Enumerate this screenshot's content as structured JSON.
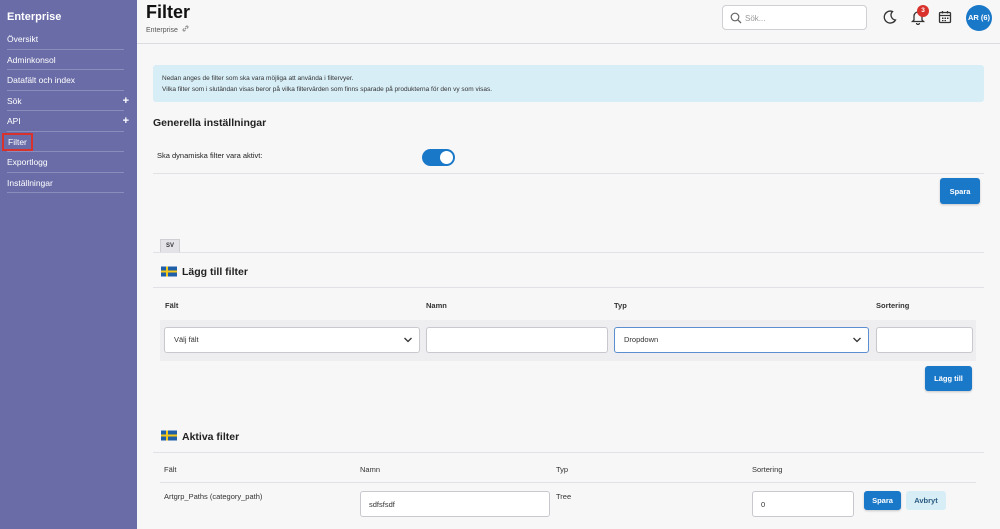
{
  "sidebar": {
    "title": "Enterprise",
    "items": [
      {
        "label": "Översikt",
        "expandable": false
      },
      {
        "label": "Adminkonsol",
        "expandable": false
      },
      {
        "label": "Datafält och index",
        "expandable": false
      },
      {
        "label": "Sök",
        "expandable": true
      },
      {
        "label": "API",
        "expandable": true
      },
      {
        "label": "Filter",
        "expandable": false,
        "active": true
      },
      {
        "label": "Exportlogg",
        "expandable": false
      },
      {
        "label": "Inställningar",
        "expandable": false
      }
    ],
    "plus_symbol": "+"
  },
  "header": {
    "title": "Filter",
    "breadcrumb": "Enterprise",
    "breadcrumb_icon": "link-icon",
    "search_placeholder": "Sök...",
    "notification_count": "3",
    "avatar_text": "AR (6)",
    "icons": [
      "search-icon",
      "moon-icon",
      "bell-icon",
      "calendar-icon"
    ]
  },
  "info": {
    "line1": "Nedan anges de filter som ska vara möjliga att använda i filtervyer.",
    "line2": "Vilka filter som i slutändan visas beror på vilka filtervärden som finns sparade på produkterna för den vy som visas."
  },
  "general": {
    "title": "Generella inställningar",
    "dynamic_label": "Ska dynamiska filter vara aktivt:",
    "dynamic_enabled": true,
    "save_label": "Spara"
  },
  "language_tab": "SV",
  "add_filter": {
    "title": "Lägg till filter",
    "columns": {
      "field": "Fält",
      "name": "Namn",
      "type": "Typ",
      "sort": "Sortering"
    },
    "field_select": "Välj fält",
    "name_value": "",
    "type_select": "Dropdown",
    "sort_value": "",
    "add_label": "Lägg till"
  },
  "active_filters": {
    "title": "Aktiva filter",
    "columns": {
      "field": "Fält",
      "name": "Namn",
      "type": "Typ",
      "sort": "Sortering"
    },
    "rows": [
      {
        "field": "Artgrp_Paths (category_path)",
        "name": "sdfsfsdf",
        "type": "Tree",
        "sort": "0",
        "save_label": "Spara",
        "cancel_label": "Avbryt"
      }
    ]
  },
  "colors": {
    "sidebar_bg": "#6a6ca8",
    "primary": "#1a78c8",
    "info_bg": "#d8eef7",
    "badge": "#d9312b",
    "active_outline": "#d9312b"
  }
}
